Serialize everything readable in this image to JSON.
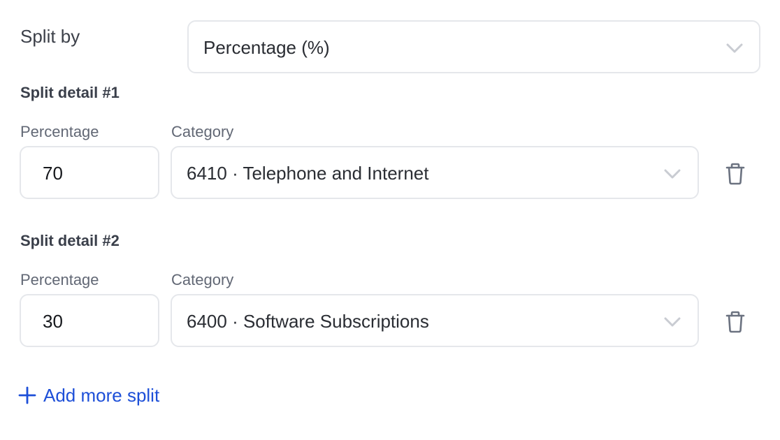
{
  "split_by": {
    "label": "Split by",
    "value": "Percentage (%)"
  },
  "splits": [
    {
      "title": "Split detail #1",
      "percentage_label": "Percentage",
      "percentage_value": "70",
      "category_label": "Category",
      "category_value": "6410 · Telephone and Internet"
    },
    {
      "title": "Split detail #2",
      "percentage_label": "Percentage",
      "percentage_value": "30",
      "category_label": "Category",
      "category_value": "6400 · Software Subscriptions"
    }
  ],
  "add_more": {
    "label": "Add more split"
  },
  "icons": {
    "chevron": "chevron-down-icon",
    "delete": "trash-icon",
    "add": "plus-icon"
  },
  "colors": {
    "accent": "#1d4fd8",
    "border": "#e5e7eb",
    "label": "#626875",
    "icon": "#6b7280"
  }
}
